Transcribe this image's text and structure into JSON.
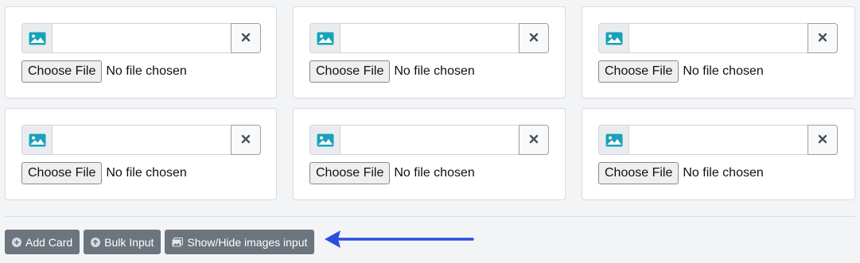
{
  "cards": [
    {
      "url_value": "",
      "choose_label": "Choose File",
      "file_status": "No file chosen"
    },
    {
      "url_value": "",
      "choose_label": "Choose File",
      "file_status": "No file chosen"
    },
    {
      "url_value": "",
      "choose_label": "Choose File",
      "file_status": "No file chosen"
    },
    {
      "url_value": "",
      "choose_label": "Choose File",
      "file_status": "No file chosen"
    },
    {
      "url_value": "",
      "choose_label": "Choose File",
      "file_status": "No file chosen"
    },
    {
      "url_value": "",
      "choose_label": "Choose File",
      "file_status": "No file chosen"
    }
  ],
  "icons": {
    "image_prepend": "image-icon",
    "clear": "close-icon",
    "add": "plus-circle-icon",
    "bulk": "upload-circle-icon",
    "images": "images-icon",
    "annotation": "arrow-left-icon"
  },
  "toolbar": {
    "add_card_label": "Add Card",
    "bulk_input_label": "Bulk Input",
    "show_hide_label": "Show/Hide images input"
  },
  "colors": {
    "image_icon": "#17a2b8",
    "toolbar_button": "#6c757d",
    "annotation_arrow": "#2a4fe0"
  }
}
